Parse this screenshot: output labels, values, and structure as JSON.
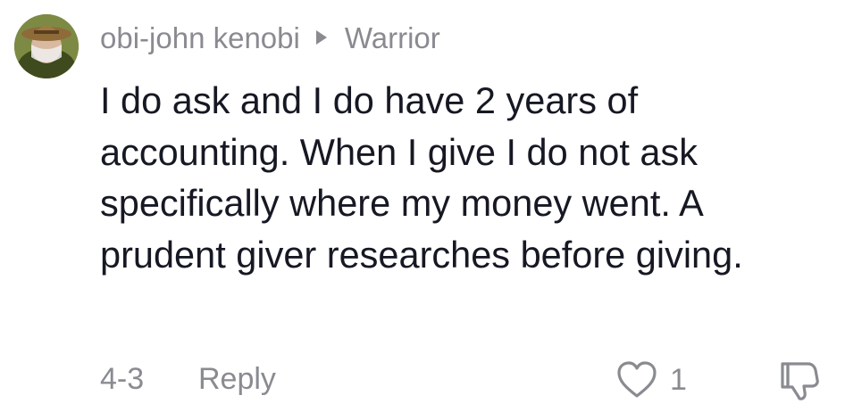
{
  "comment": {
    "author": {
      "username": "obi-john kenobi",
      "avatar_icon": "user-avatar-photo"
    },
    "reply_to": {
      "arrow_icon": "triangle-right-icon",
      "username": "Warrior"
    },
    "text": "I do ask and I do have 2 years of accounting. When I give I do not ask specifically where my money went. A prudent giver researches before giving.",
    "date": "4-3",
    "reply_label": "Reply",
    "likes": {
      "icon": "heart-outline-icon",
      "count": "1"
    },
    "dislike_icon": "thumbs-down-outline-icon"
  },
  "colors": {
    "text_primary": "#161823",
    "text_secondary": "#8a8b91",
    "background": "#ffffff"
  }
}
